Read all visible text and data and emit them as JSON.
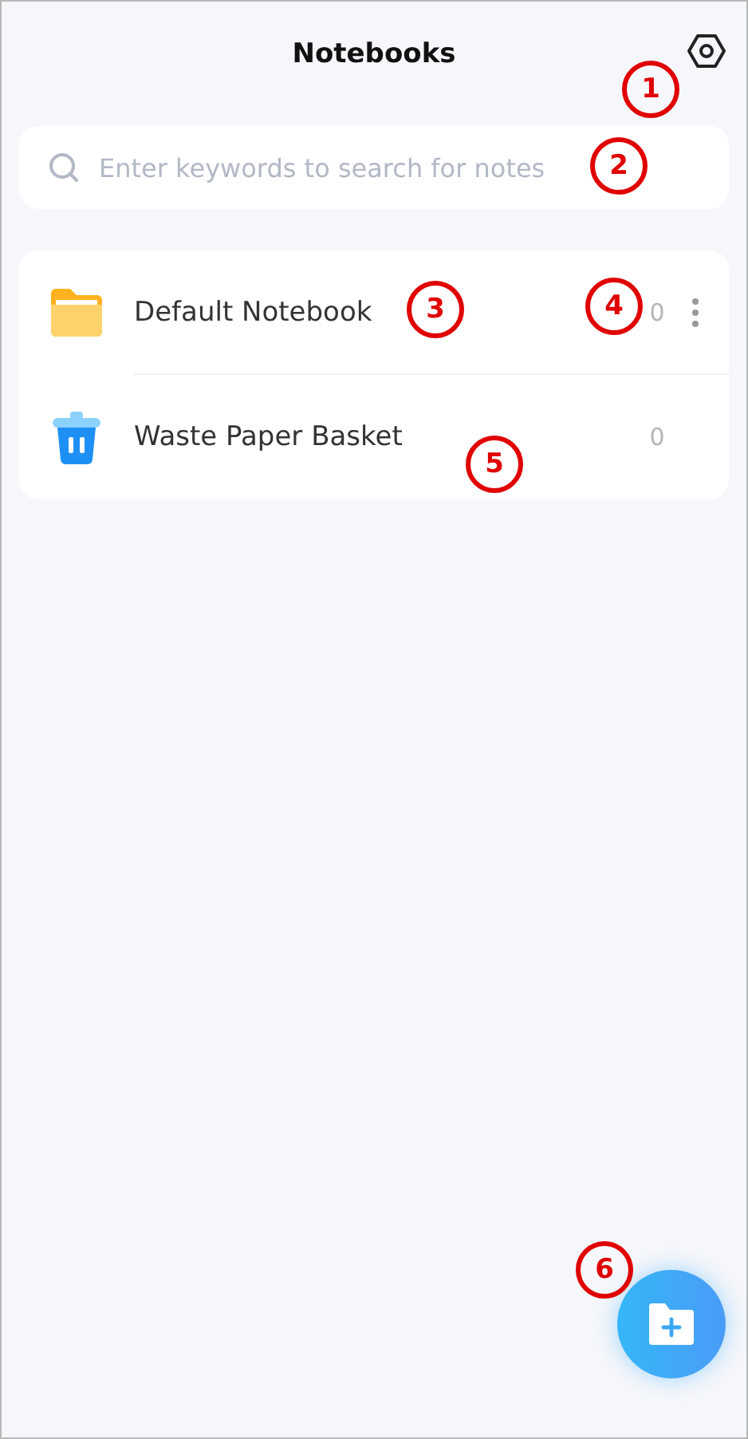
{
  "header": {
    "title": "Notebooks"
  },
  "search": {
    "placeholder": "Enter keywords to search for notes"
  },
  "notebooks": [
    {
      "kind": "folder",
      "name": "Default Notebook",
      "count": "0",
      "menu": true
    },
    {
      "kind": "trash",
      "name": "Waste Paper Basket",
      "count": "0",
      "menu": false
    }
  ],
  "callouts": [
    "1",
    "2",
    "3",
    "4",
    "5",
    "6"
  ]
}
